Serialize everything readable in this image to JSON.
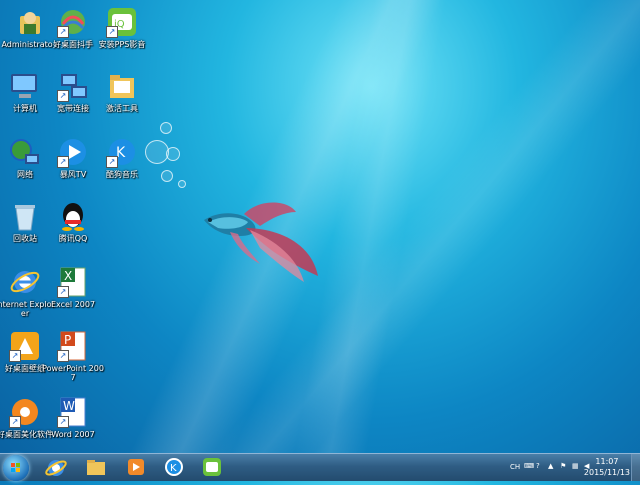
{
  "desktop": {
    "icons": [
      {
        "label": "Administrato r",
        "icon": "user-folder-icon"
      },
      {
        "label": "好桌面抖手",
        "icon": "haozhuomian-app-icon"
      },
      {
        "label": "安装PPS影音",
        "icon": "pps-icon"
      },
      {
        "label": "计算机",
        "icon": "computer-icon"
      },
      {
        "label": "宽带连接",
        "icon": "network-connection-icon"
      },
      {
        "label": "激活工具",
        "icon": "folder-icon"
      },
      {
        "label": "网络",
        "icon": "network-icon"
      },
      {
        "label": "暴风TV",
        "icon": "baofeng-icon"
      },
      {
        "label": "酷狗音乐",
        "icon": "kugou-icon"
      },
      {
        "label": "回收站",
        "icon": "recycle-bin-icon"
      },
      {
        "label": "腾讯QQ",
        "icon": "qq-icon"
      },
      {
        "label": "Internet Explorer",
        "icon": "ie-icon"
      },
      {
        "label": "Excel 2007",
        "icon": "excel-icon"
      },
      {
        "label": "好桌面壁纸",
        "icon": "wallpaper-app-icon"
      },
      {
        "label": "PowerPoint 2007",
        "icon": "powerpoint-icon"
      },
      {
        "label": "好桌面美化软件",
        "icon": "beautify-app-icon"
      },
      {
        "label": "Word 2007",
        "icon": "word-icon"
      }
    ]
  },
  "taskbar": {
    "pinned": [
      "start-button",
      "ie",
      "explorer",
      "media-player",
      "kugou",
      "pps"
    ],
    "tray": {
      "lang": "CH",
      "time": "11:07",
      "date": "2015/11/13"
    }
  }
}
